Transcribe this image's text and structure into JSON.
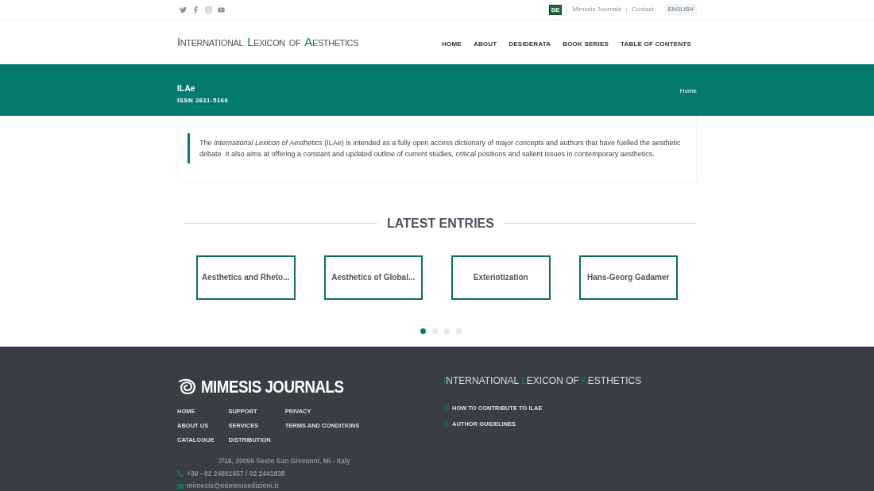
{
  "topbar": {
    "links": [
      "Mimesis Journals",
      "Contact"
    ],
    "language": "ENGLISH",
    "badge": "SE"
  },
  "logo": [
    {
      "initial": "I",
      "rest": "NTERNATIONAL",
      "accent": false
    },
    {
      "initial": "L",
      "rest": "EXICON",
      "accent": true
    },
    {
      "rest": "OF"
    },
    {
      "initial": "A",
      "rest": "ESTHETICS",
      "accent": true
    }
  ],
  "nav": [
    "HOME",
    "ABOUT",
    "DESIDERATA",
    "BOOK SERIES",
    "TABLE OF CONTENTS"
  ],
  "banner": {
    "title": "ILAe",
    "issn": "ISSN 2611-5166",
    "breadcrumb": "Home"
  },
  "intro": "The *International Lexicon of Aesthetics* (ILAe) is intended as a fully open access dictionary of major concepts and authors that have fuelled the aesthetic debate. It also aims at offering a constant and updated outline of current studies, critical positions and salient issues in contemporary aesthetics.",
  "latest": {
    "heading": "LATEST ENTRIES",
    "entries": [
      "Aesthetics and Rheto...",
      "Aesthetics of Global...",
      "Exteriotization",
      "Hans-Georg Gadamer"
    ],
    "dots": [
      {
        "selected": true
      },
      {
        "selected": false
      },
      {
        "selected": false
      },
      {
        "selected": false
      }
    ]
  },
  "footer": {
    "brand": "MIMESIS JOURNALS",
    "links": [
      [
        "HOME",
        "ABOUT US",
        "CATALOGUE"
      ],
      [
        "SUPPORT",
        "SERVICES",
        "DISTRIBUTION"
      ],
      [
        "PRIVACY",
        "TERMS AND CONDITIONS"
      ]
    ],
    "contact": [
      "7/19, 20099 Sesto San Giovanni, MI - Italy",
      "+39 - 02 24861657 / 02 2441638",
      "mimesis@mimesisedizioni.it"
    ],
    "logo": [
      {
        "initial": "I",
        "rest": "NTERNATIONAL"
      },
      {
        "initial": "L",
        "rest": "EXICON OF"
      },
      {
        "initial": "A",
        "rest": "ESTHETICS"
      }
    ],
    "links_right": [
      "HOW TO CONTRIBUTE TO ILAE",
      "AUTHOR GUIDELINES"
    ]
  }
}
